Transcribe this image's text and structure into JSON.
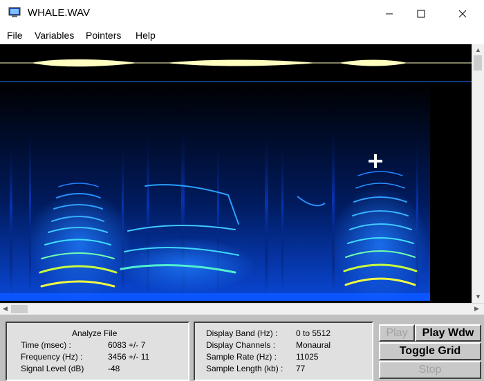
{
  "window": {
    "title": "WHALE.WAV"
  },
  "menu": {
    "items": [
      "File",
      "Variables",
      "Pointers",
      "Help"
    ]
  },
  "analyze": {
    "heading": "Analyze File",
    "rows": [
      {
        "label": "Time (msec) :",
        "value": "6083 +/- 7"
      },
      {
        "label": "Frequency (Hz) :",
        "value": "3456 +/- 11"
      },
      {
        "label": "Signal Level (dB)",
        "value": "-48"
      }
    ]
  },
  "info": {
    "rows": [
      {
        "label": "Display Band (Hz) :",
        "value": "0 to 5512"
      },
      {
        "label": "Display Channels :",
        "value": "Monaural"
      },
      {
        "label": "Sample Rate (Hz) :",
        "value": "11025"
      },
      {
        "label": "Sample Length (kb) :",
        "value": "77"
      }
    ]
  },
  "buttons": {
    "play": "Play",
    "play_wdw": "Play Wdw",
    "toggle_grid": "Toggle Grid",
    "stop": "Stop"
  },
  "colors": {
    "spectrogram_bg": "#000000",
    "waveform": "#ffffc0",
    "accent_blue": "#1e6fff"
  }
}
